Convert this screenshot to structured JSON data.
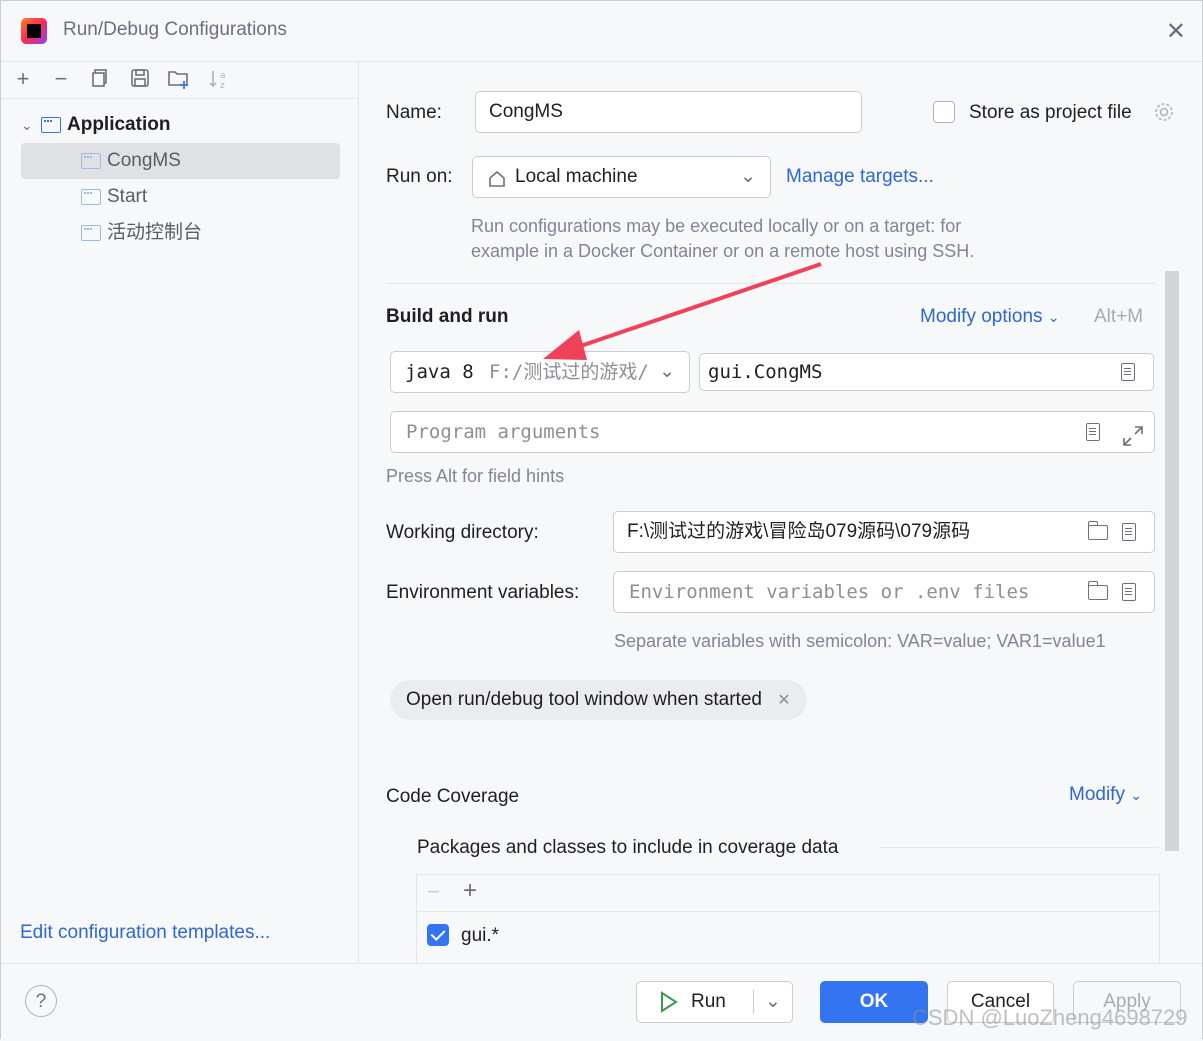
{
  "window": {
    "title": "Run/Debug Configurations",
    "logo_text": "IJ"
  },
  "left_panel": {
    "toolbar_icons": [
      "add-icon",
      "remove-icon",
      "copy-icon",
      "save-icon",
      "new-folder-icon",
      "sort-icon"
    ],
    "tree": {
      "group": "Application",
      "items": [
        "CongMS",
        "Start",
        "活动控制台"
      ],
      "selected": "CongMS"
    },
    "edit_templates_link": "Edit configuration templates..."
  },
  "form": {
    "name_label": "Name:",
    "name_value": "CongMS",
    "store_label": "Store as project file",
    "store_checked": false,
    "run_on_label": "Run on:",
    "run_on_value": "Local machine",
    "manage_targets": "Manage targets...",
    "run_on_hint_line1": "Run configurations may be executed locally or on a target: for",
    "run_on_hint_line2": "example in a Docker Container or on a remote host using SSH.",
    "build_and_run_title": "Build and run",
    "modify_options": "Modify options",
    "modify_shortcut": "Alt+M",
    "jdk_version": "java 8",
    "jdk_path": "F:/测试过的游戏/",
    "main_class": "gui.CongMS",
    "program_args_placeholder": "Program arguments",
    "field_hints": "Press Alt for field hints",
    "working_dir_label": "Working directory:",
    "working_dir_value": "F:\\测试过的游戏\\冒险岛079源码\\079源码",
    "env_label": "Environment variables:",
    "env_placeholder": "Environment variables or .env files",
    "env_hint": "Separate variables with semicolon: VAR=value; VAR1=value1",
    "chip_label": "Open run/debug tool window when started",
    "code_coverage_title": "Code Coverage",
    "modify_link": "Modify",
    "packages_title": "Packages and classes to include in coverage data",
    "coverage_items": [
      {
        "label": "gui.*",
        "checked": true
      }
    ]
  },
  "buttons": {
    "run": "Run",
    "ok": "OK",
    "cancel": "Cancel",
    "apply": "Apply",
    "help": "?"
  },
  "watermark": "CSDN @LuoZheng4698729",
  "colors": {
    "accent": "#3574f0",
    "annotation_arrow": "#f0415a",
    "link": "#2f66d4"
  }
}
